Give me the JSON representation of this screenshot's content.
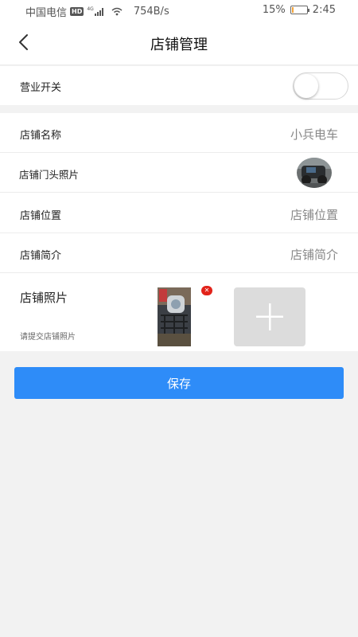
{
  "status_bar": {
    "carrier": "中国电信",
    "network_badge": "HD",
    "signal_type": "4G",
    "speed": "754B/s",
    "battery_percent": "15%",
    "battery_level": 0.15,
    "time": "2:45"
  },
  "header": {
    "title": "店铺管理",
    "back_icon": "chevron-left-icon"
  },
  "business_switch": {
    "label": "营业开关",
    "enabled": false
  },
  "shop_name": {
    "label": "店铺名称",
    "value": "小兵电车"
  },
  "storefront_photo": {
    "label": "店铺门头照片"
  },
  "shop_location": {
    "label": "店铺位置",
    "value": "店铺位置"
  },
  "shop_intro": {
    "label": "店铺简介",
    "value": "店铺简介"
  },
  "shop_photos": {
    "title": "店铺照片",
    "hint": "请提交店铺照片",
    "remove_icon": "close-icon",
    "add_icon": "plus-icon"
  },
  "save_button": {
    "label": "保存"
  },
  "colors": {
    "primary": "#2e8cf8",
    "remove_badge": "#e2231a",
    "background": "#f2f2f2"
  }
}
